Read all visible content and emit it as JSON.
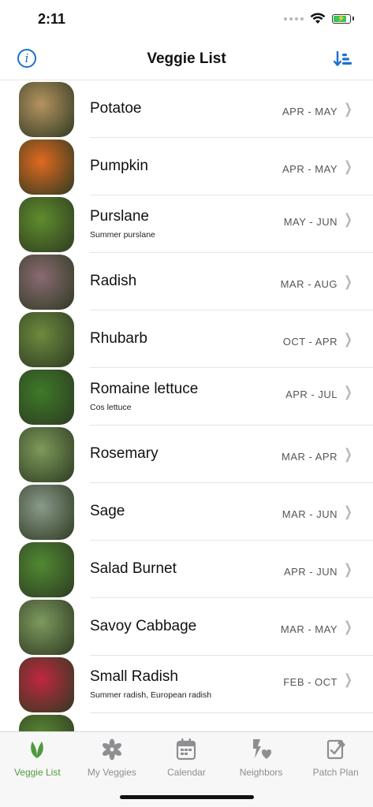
{
  "status_bar": {
    "time": "2:11"
  },
  "nav": {
    "title": "Veggie List",
    "info_icon": "info-icon",
    "sort_icon": "sort-descending-icon",
    "accent": "#1a6fd6"
  },
  "veggies": [
    {
      "name": "Potatoe",
      "subtitle": "",
      "season": "APR - MAY",
      "color": "#b69360"
    },
    {
      "name": "Pumpkin",
      "subtitle": "",
      "season": "APR - MAY",
      "color": "#e06a1f"
    },
    {
      "name": "Purslane",
      "subtitle": "Summer purslane",
      "season": "MAY - JUN",
      "color": "#5f8d2c"
    },
    {
      "name": "Radish",
      "subtitle": "",
      "season": "MAR - AUG",
      "color": "#8a6a72"
    },
    {
      "name": "Rhubarb",
      "subtitle": "",
      "season": "OCT - APR",
      "color": "#6e8a3e"
    },
    {
      "name": "Romaine lettuce",
      "subtitle": "Cos lettuce",
      "season": "APR - JUL",
      "color": "#3d7a27"
    },
    {
      "name": "Rosemary",
      "subtitle": "",
      "season": "MAR - APR",
      "color": "#7d9a5a"
    },
    {
      "name": "Sage",
      "subtitle": "",
      "season": "MAR - JUN",
      "color": "#8a9a8a"
    },
    {
      "name": "Salad Burnet",
      "subtitle": "",
      "season": "APR - JUN",
      "color": "#4f8a32"
    },
    {
      "name": "Savoy Cabbage",
      "subtitle": "",
      "season": "MAR - MAY",
      "color": "#7d9a5e"
    },
    {
      "name": "Small Radish",
      "subtitle": "Summer radish, European radish",
      "season": "FEB - OCT",
      "color": "#c0283e"
    },
    {
      "name": "",
      "subtitle": "",
      "season": "",
      "color": "#5a8a32"
    }
  ],
  "tabs": [
    {
      "label": "Veggie List",
      "icon": "leaf-icon",
      "active": true
    },
    {
      "label": "My Veggies",
      "icon": "flower-icon",
      "active": false
    },
    {
      "label": "Calendar",
      "icon": "calendar-icon",
      "active": false
    },
    {
      "label": "Neighbors",
      "icon": "neighbors-icon",
      "active": false
    },
    {
      "label": "Patch Plan",
      "icon": "patch-plan-icon",
      "active": false
    }
  ],
  "colors": {
    "active_tab": "#4f9a3f",
    "inactive_tab": "#8e8e93",
    "battery": "#34c759"
  }
}
